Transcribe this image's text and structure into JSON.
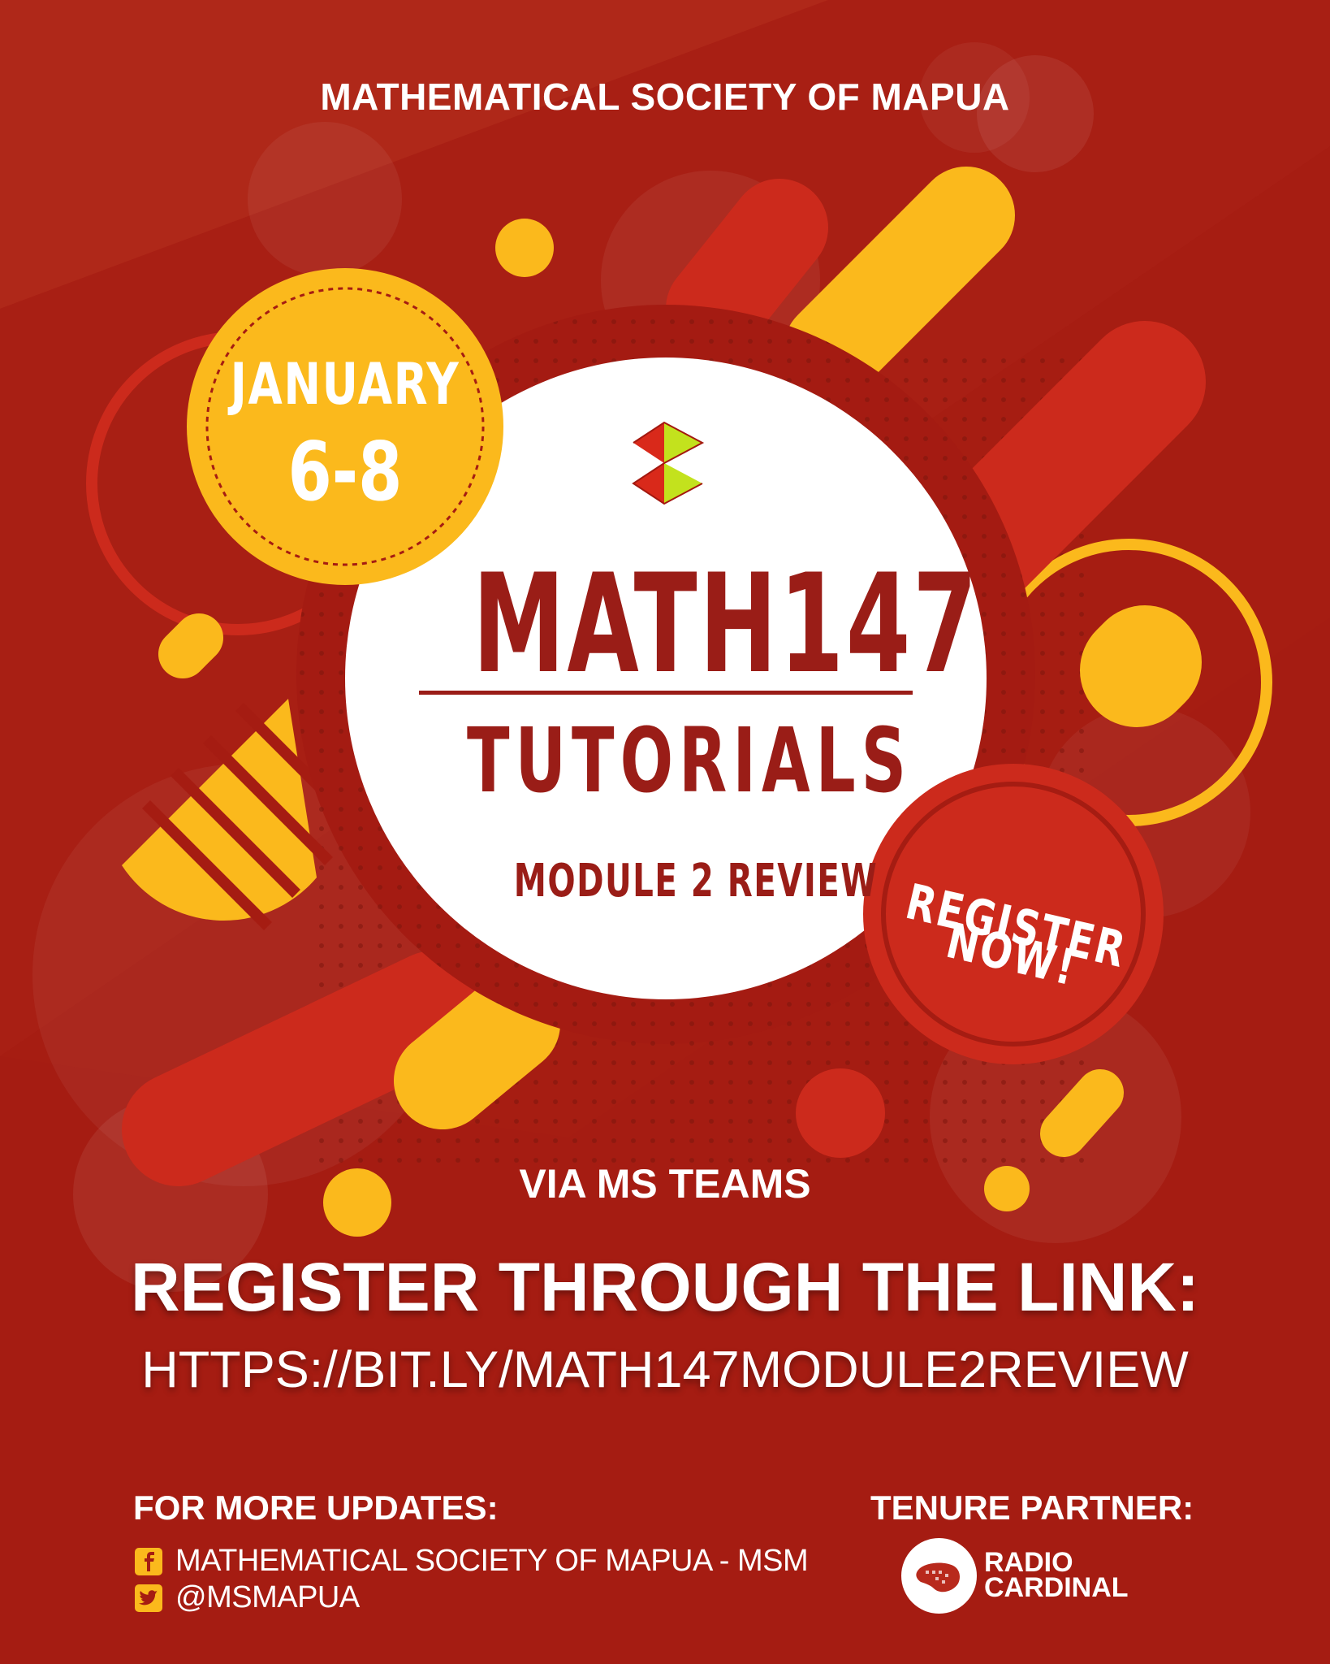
{
  "organization": "MATHEMATICAL SOCIETY OF MAPUA",
  "event": {
    "date_month": "JANUARY",
    "date_days": "6-8",
    "course_code": "MATH147",
    "course_subtitle": "TUTORIALS",
    "module": "MODULE 2 REVIEW",
    "register_badge_line1": "REGISTER",
    "register_badge_line2": "NOW!",
    "platform": "VIA MS TEAMS"
  },
  "registration": {
    "heading": "REGISTER THROUGH THE LINK:",
    "link": "HTTPS://BIT.LY/MATH147MODULE2REVIEW"
  },
  "footer": {
    "updates_heading": "FOR MORE UPDATES:",
    "facebook": {
      "icon": "facebook-icon",
      "label": "MATHEMATICAL SOCIETY OF MAPUA - MSM"
    },
    "twitter": {
      "icon": "twitter-icon",
      "label": "@MSMAPUA"
    },
    "partner_heading": "TENURE PARTNER:",
    "partner_line1": "RADIO",
    "partner_line2": "CARDINAL"
  },
  "colors": {
    "background": "#a51c12",
    "accent_yellow": "#fbb91c",
    "accent_red": "#cc2a1c",
    "title_red": "#9a1d17",
    "white": "#ffffff"
  }
}
